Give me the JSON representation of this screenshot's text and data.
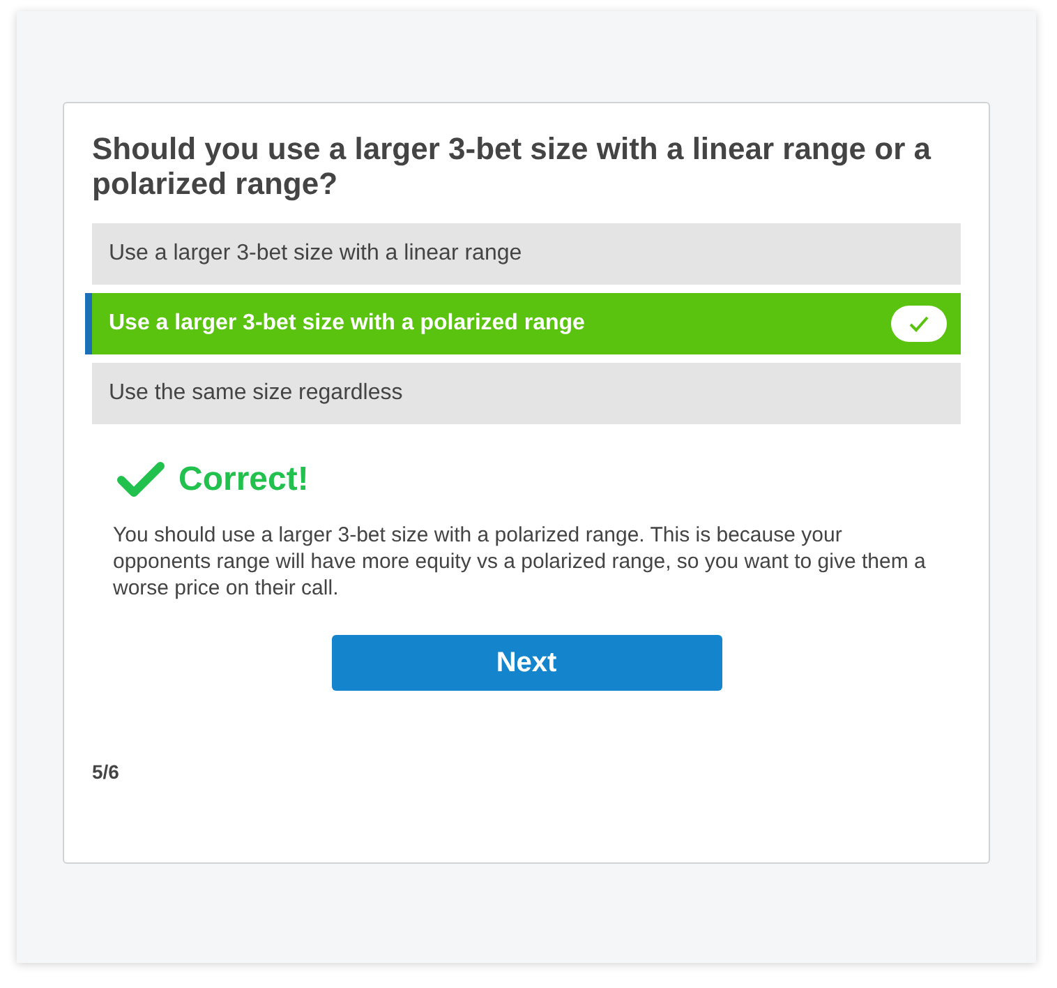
{
  "question": "Should you use a larger 3-bet size with a linear range or a polarized range?",
  "options": [
    {
      "label": "Use a larger 3-bet size with a linear range",
      "selected": false
    },
    {
      "label": "Use a larger 3-bet size with a polarized range",
      "selected": true
    },
    {
      "label": "Use the same size regardless",
      "selected": false
    }
  ],
  "feedback": {
    "correct": true,
    "title": "Correct!",
    "text": "You should use a larger 3-bet size with a polarized range. This is because your opponents range will have more equity vs a polarized range, so you want to give them a worse price on their call."
  },
  "next_button": "Next",
  "progress": "5/6"
}
